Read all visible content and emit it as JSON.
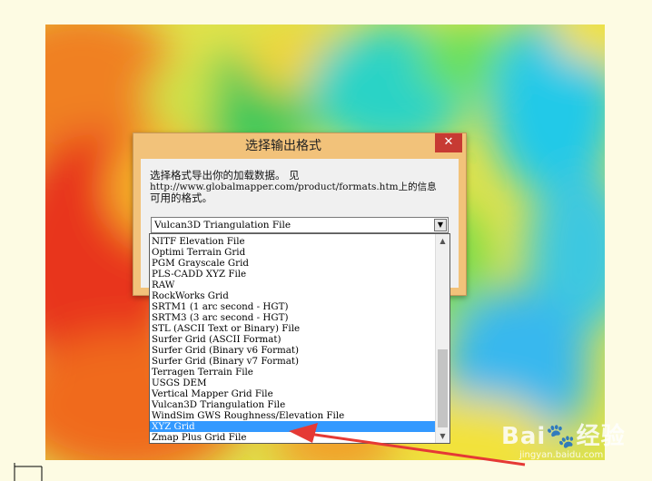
{
  "dialog": {
    "title": "选择输出格式",
    "close_glyph": "✕",
    "description_line1": "选择格式导出你的加载数据。 见",
    "description_url": "http://www.globalmapper.com/product/formats.htm上的信息",
    "description_line3": "可用的格式。"
  },
  "format_combo": {
    "selected_value": "Vulcan3D Triangulation File",
    "arrow_glyph": "▼"
  },
  "format_list": {
    "items": [
      "NITF Elevation File",
      "Optimi Terrain Grid",
      "PGM Grayscale Grid",
      "PLS-CADD XYZ File",
      "RAW",
      "RockWorks Grid",
      "SRTM1 (1 arc second - HGT)",
      "SRTM3 (3 arc second - HGT)",
      "STL (ASCII Text or Binary) File",
      "Surfer Grid (ASCII Format)",
      "Surfer Grid (Binary v6 Format)",
      "Surfer Grid (Binary v7 Format)",
      "Terragen Terrain File",
      "USGS DEM",
      "Vertical Mapper Grid File",
      "Vulcan3D Triangulation File",
      "WindSim GWS Roughness/Elevation File",
      "XYZ Grid",
      "Zmap Plus Grid File"
    ],
    "selected_index": 17,
    "scroll_up_glyph": "▲",
    "scroll_down_glyph": "▼"
  },
  "watermark": {
    "logo": "Bai🐾经验",
    "subtitle": "jingyan.baidu.com"
  },
  "colors": {
    "selection": "#3399ff",
    "arrow": "#e53935",
    "close_button": "#c73a33",
    "dialog_frame": "#f2c27a"
  }
}
